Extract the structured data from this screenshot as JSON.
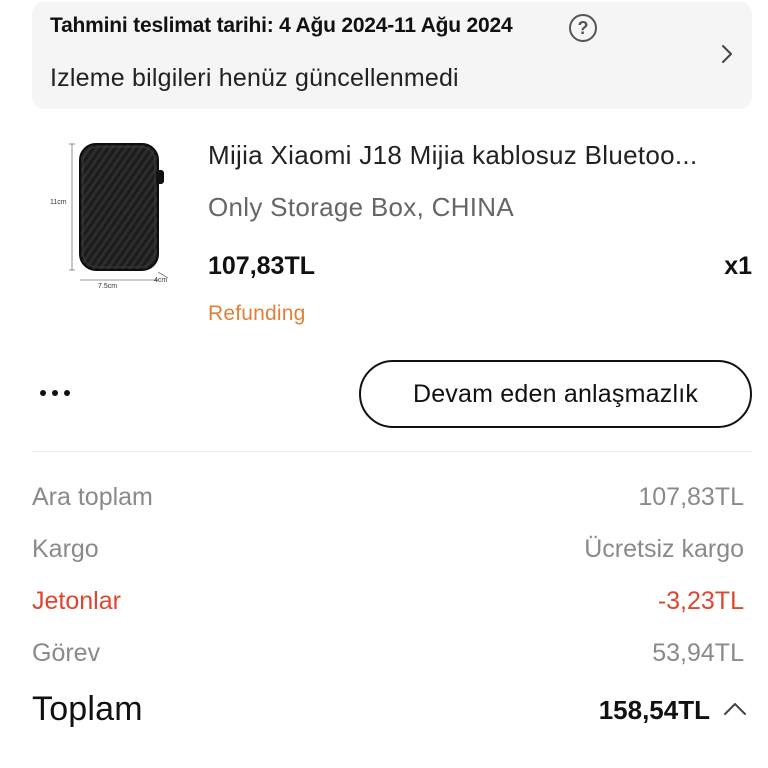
{
  "delivery": {
    "estimated_label": "Tahmini teslimat tarihi: 4 Ağu 2024-11 Ağu 2024",
    "help_icon": "question-circle-icon",
    "tracking_status": "Izleme bilgileri henüz güncellenmedi",
    "chevron_icon": "chevron-right-icon"
  },
  "product": {
    "title": "Mijia Xiaomi J18 Mijia kablosuz Bluetoo...",
    "variant": "Only Storage Box, CHINA",
    "price": "107,83TL",
    "quantity": "x1",
    "status": "Refunding",
    "image_labels": {
      "height": "11cm",
      "width": "7.5cm",
      "depth": "4cm"
    }
  },
  "actions": {
    "more_icon": "more-horizontal-icon",
    "dispute_label": "Devam eden anlaşmazlık"
  },
  "summary": {
    "rows": [
      {
        "label": "Ara toplam",
        "value": "107,83TL"
      },
      {
        "label": "Kargo",
        "value": "Ücretsiz kargo"
      },
      {
        "label": "Jetonlar",
        "value": "-3,23TL"
      },
      {
        "label": "Görev",
        "value": "53,94TL"
      }
    ],
    "total_label": "Toplam",
    "total_value": "158,54TL",
    "collapse_icon": "chevron-up-icon"
  },
  "colors": {
    "card_background": "#f5f5f5",
    "refund_orange": "#e0803a",
    "discount_red": "#e0452f",
    "muted_gray": "#8a8a8a"
  }
}
